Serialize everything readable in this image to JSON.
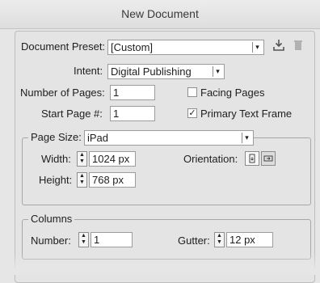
{
  "window": {
    "title": "New Document"
  },
  "preset": {
    "label": "Document Preset:",
    "value": "[Custom]"
  },
  "intent": {
    "label": "Intent:",
    "value": "Digital Publishing"
  },
  "pages": {
    "number_label": "Number of Pages:",
    "number_value": "1",
    "start_label": "Start Page #:",
    "start_value": "1",
    "facing_label": "Facing Pages",
    "facing_checked": false,
    "primary_label": "Primary Text Frame",
    "primary_checked": true
  },
  "page_size": {
    "label": "Page Size:",
    "value": "iPad",
    "width_label": "Width:",
    "width_value": "1024 px",
    "height_label": "Height:",
    "height_value": "768 px",
    "orientation_label": "Orientation:",
    "orientation_selected": "landscape"
  },
  "columns": {
    "legend": "Columns",
    "number_label": "Number:",
    "number_value": "1",
    "gutter_label": "Gutter:",
    "gutter_value": "12 px"
  },
  "icons": [
    "save-preset-icon",
    "delete-preset-icon",
    "portrait-icon",
    "landscape-icon",
    "stepper-icon",
    "chevron-down-icon",
    "checkmark-icon"
  ]
}
